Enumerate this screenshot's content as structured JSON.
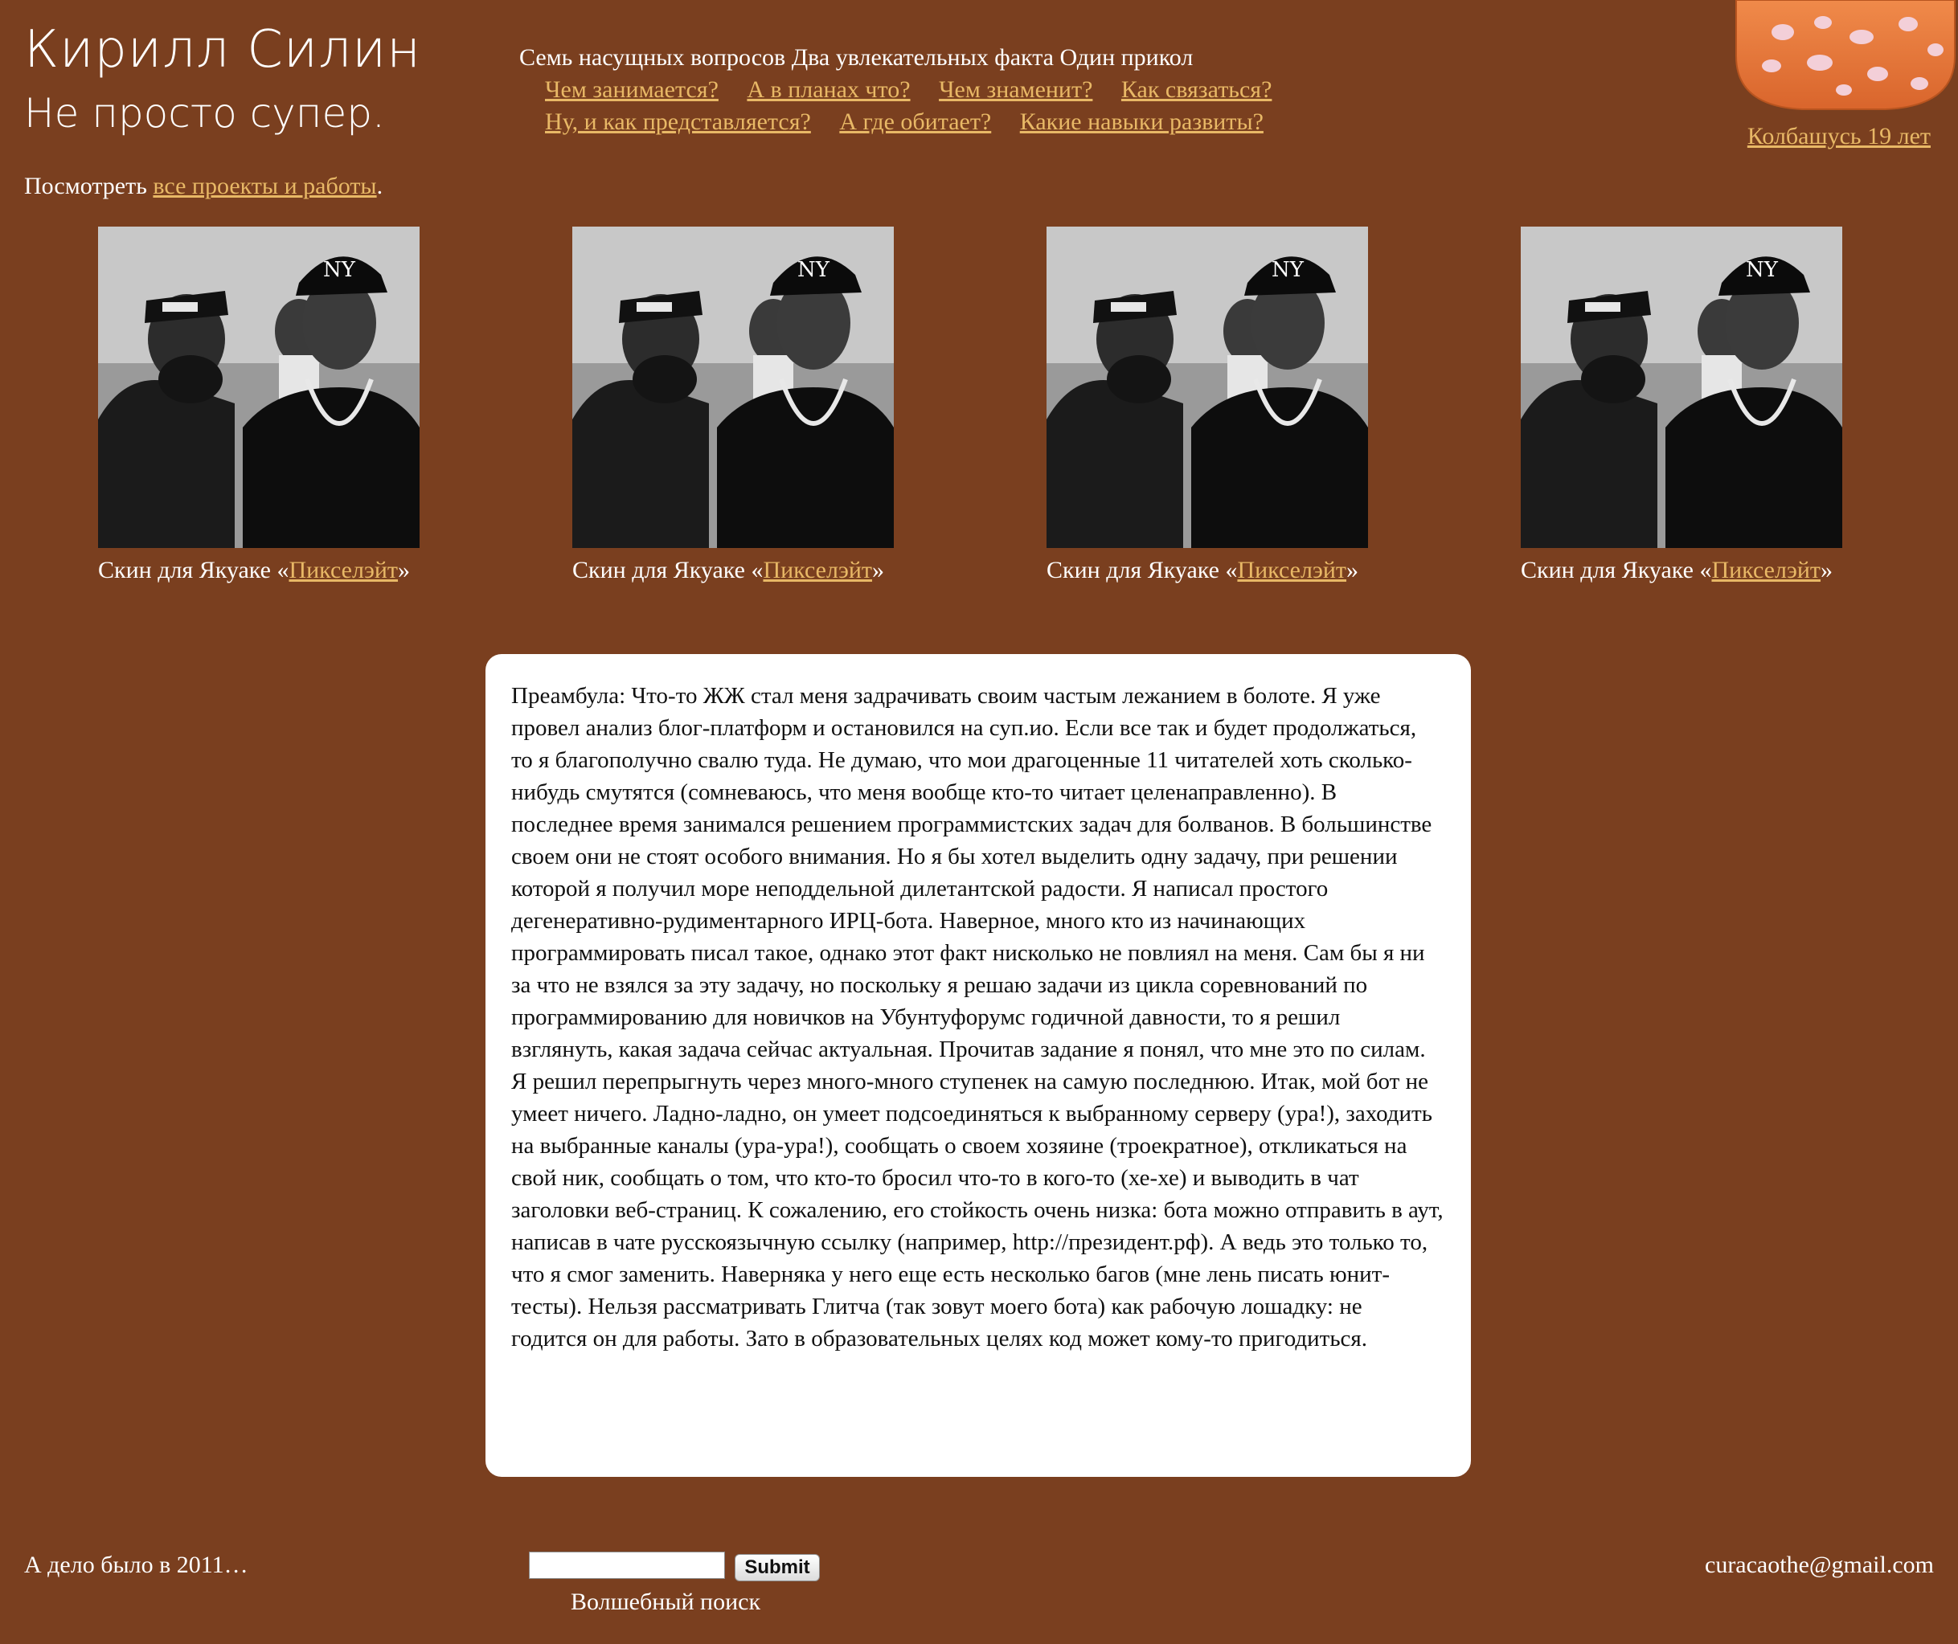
{
  "header": {
    "title": "Кирилл Силин",
    "tagline": "Не просто супер."
  },
  "nav": {
    "heading": "Семь насущных вопросов Два увлекательных факта Один прикол",
    "links_row1": [
      "Чем занимается?",
      "А в планах что?",
      "Чем знаменит?",
      "Как связаться?"
    ],
    "links_row2": [
      "Ну, и как представляется?",
      "А где обитает?",
      "Какие навыки развиты?"
    ]
  },
  "logo": {
    "icon": "sausage-icon",
    "link_text": "Колбашусь 19 лет",
    "colors": {
      "body": "#e8743a",
      "spots": "#f3cfd8"
    }
  },
  "projects_line": {
    "prefix": "Посмотреть",
    "link": "все проекты и работы",
    "suffix": "."
  },
  "cards": [
    {
      "caption_prefix": "Скин для Якуаке «",
      "caption_link": "Пикселэйт",
      "caption_suffix": "»"
    },
    {
      "caption_prefix": "Скин для Якуаке «",
      "caption_link": "Пикселэйт",
      "caption_suffix": "»"
    },
    {
      "caption_prefix": "Скин для Якуаке «",
      "caption_link": "Пикселэйт",
      "caption_suffix": "»"
    },
    {
      "caption_prefix": "Скин для Якуаке «",
      "caption_link": "Пикселэйт",
      "caption_suffix": "»"
    }
  ],
  "article": {
    "text": "Преамбула: Что-то ЖЖ стал меня задрачивать своим частым лежанием в болоте. Я уже провел анализ блог-платформ и остановился на суп.ио. Если все так и будет продолжаться, то я благополучно свалю туда. Не думаю, что мои драгоценные 11 читателей хоть сколько-нибудь смутятся (сомневаюсь, что меня вообще кто-то читает целенаправленно). В последнее время занимался решением программистских задач для болванов. В большинстве своем они не стоят особого внимания. Но я бы хотел выделить одну задачу, при решении которой я получил море неподдельной дилетантской радости. Я написал простого дегенеративно-рудиментарного ИРЦ-бота. Наверное, много кто из начинающих программировать писал такое, однако этот факт нисколько не повлиял на меня. Сам бы я ни за что не взялся за эту задачу, но поскольку я решаю задачи из цикла соревнований по программированию для новичков на Убунтуфорумс годичной давности, то я решил взглянуть, какая задача сейчас актуальная. Прочитав задание я понял, что мне это по силам. Я решил перепрыгнуть через много-много ступенек на самую последнюю. Итак, мой бот не умеет ничего. Ладно-ладно, он умеет подсоединяться к выбранному серверу (ура!), заходить на выбранные каналы (ура-ура!), сообщать о своем хозяине (троекратное), откликаться на свой ник, сообщать о том, что кто-то бросил что-то в кого-то (хе-хе) и выводить в чат заголовки веб-страниц. К сожалению, его стойкость очень низка: бота можно отправить в аут, написав в чате русскоязычную ссылку (например, http://президент.рф). А ведь это только то, что я смог заменить. Наверняка у него еще есть несколько багов (мне лень писать юнит-тесты). Нельзя рассматривать Глитча (так зовут моего бота) как рабочую лошадку: не годится он для работы. Зато в образовательных целях код может кому-то пригодиться."
  },
  "footer": {
    "left": "А дело было в 2011…",
    "search_value": "",
    "submit_label": "Submit",
    "search_label": "Волшебный поиск",
    "email": "curacaothe@gmail.com"
  },
  "colors": {
    "background": "#7a3f1f",
    "link": "#e8b866",
    "text": "#ffffff"
  }
}
